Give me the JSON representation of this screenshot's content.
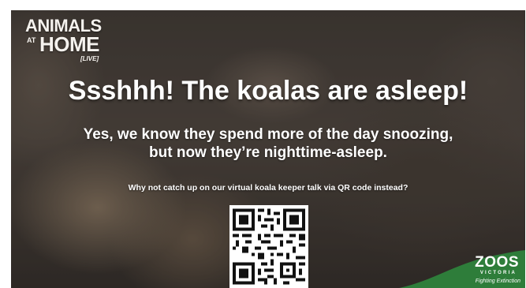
{
  "logo": {
    "line1": "ANIMALS",
    "at": "AT",
    "line2": "HOME",
    "live": "[LIVE]"
  },
  "headline": "Ssshhh! The koalas are asleep!",
  "subtext": {
    "line1": "Yes, we know they spend more of the day snoozing,",
    "line2": "but now they’re nighttime-asleep."
  },
  "cta": "Why not catch up on our virtual koala keeper talk via QR code instead?",
  "qr": {
    "icon": "qr-code-icon"
  },
  "zoos_logo": {
    "name": "ZOOS",
    "sub": "VICTORIA",
    "tagline": "Fighting Extinction",
    "color": "#2e7d3a"
  },
  "colors": {
    "text": "#ffffff",
    "zoos_green": "#2e7d3a"
  }
}
